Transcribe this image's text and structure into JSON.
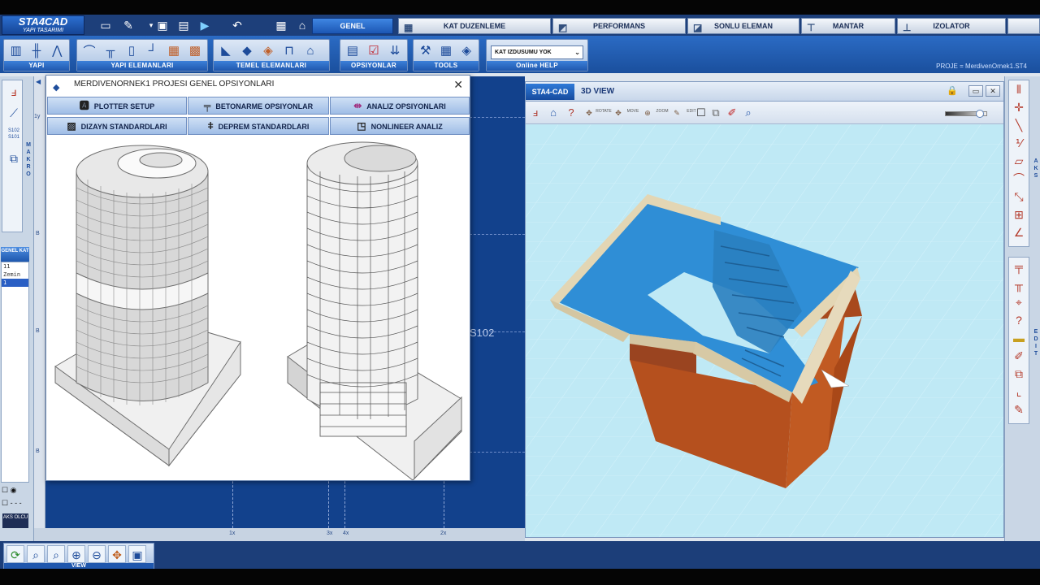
{
  "logo": {
    "title": "STA4CAD",
    "subtitle": "YAPI TASARIMI"
  },
  "tabs": [
    {
      "label": "GENEL"
    },
    {
      "label": "KAT DUZENLEME"
    },
    {
      "label": "PERFORMANS"
    },
    {
      "label": "SONLU ELEMAN"
    },
    {
      "label": "MANTAR"
    },
    {
      "label": "IZOLATOR"
    }
  ],
  "ribbon": {
    "groups": [
      {
        "label": "YAPI"
      },
      {
        "label": "YAPI ELEMANLARI"
      },
      {
        "label": "TEMEL ELEMANLARI"
      },
      {
        "label": "OPSIYONLAR"
      },
      {
        "label": "TOOLS"
      },
      {
        "label": "Online HELP"
      }
    ],
    "dropdown_value": "KAT IZDUSUMU YOK",
    "project_path": "PROJE = MerdivenOrnek1.ST4"
  },
  "leftbar": {
    "makro_label": "MAKRO",
    "genel_kat_header": "GENEL KAT",
    "floors": [
      "11",
      "Zemin",
      "1"
    ],
    "selected_floor": 2,
    "aks_olcu": "AKS OLCU",
    "sub_label": "S102\nS101"
  },
  "plan": {
    "column_label": "S102",
    "ticks_bottom": [
      "1x",
      "3x",
      "4x",
      "2x"
    ],
    "ticks_left": [
      "1y",
      "B",
      "B",
      "B",
      "B"
    ]
  },
  "dialog": {
    "title": "MERDIVENORNEK1  PROJESI GENEL OPSIYONLARI",
    "buttons": [
      {
        "label": "PLOTTER SETUP"
      },
      {
        "label": "BETONARME OPSIYONLAR"
      },
      {
        "label": "ANALIZ  OPSIYONLARI"
      },
      {
        "label": "DIZAYN STANDARDLARI"
      },
      {
        "label": "DEPREM STANDARDLARI"
      },
      {
        "label": "NONLINEER ANALIZ"
      }
    ]
  },
  "view3d": {
    "tab_main": "STA4-CAD",
    "tab_view": "3D VIEW",
    "tool_labels": {
      "rotate": "ROTATE",
      "move": "MOVE",
      "zoom": "ZOOM",
      "edit": "EDIT"
    },
    "slider_fraction": 0.8
  },
  "rightbar": {
    "aks_label": "AKS",
    "edit_label": "EDIT"
  },
  "bottombar": {
    "view_label": "VIEW",
    "zoom_labels": [
      "ALL",
      "MIN",
      "IN",
      "OUT"
    ]
  },
  "colors": {
    "plan_bg": "#12418c",
    "view_bg": "#bfe9f5",
    "slab_blue": "#2f8ed6",
    "wall_brown": "#b5501e",
    "edge_beige": "#e3d6b4",
    "accent": "#1f57ad"
  }
}
